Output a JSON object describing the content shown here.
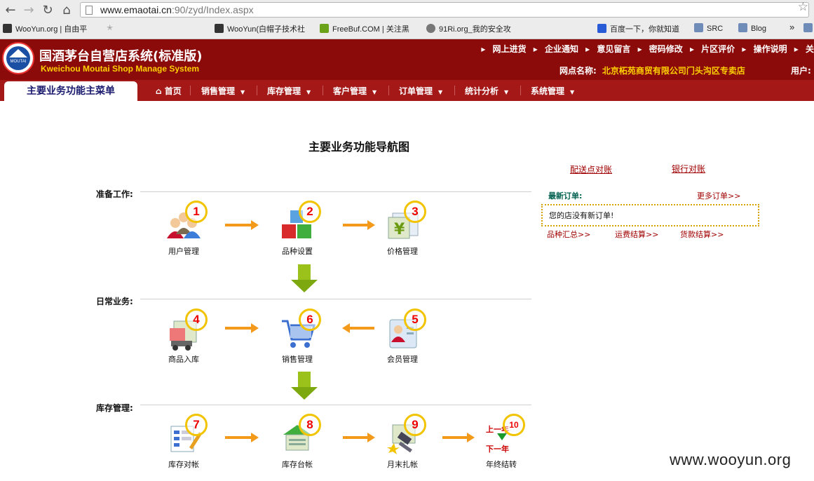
{
  "browser": {
    "url_main": "www.emaotai.cn",
    "url_rest": ":90/zyd/Index.aspx",
    "bookmarks": [
      {
        "label": "WooYun.org | 自由平",
        "color": "#333"
      },
      {
        "label": "WooYun(白帽子技术社",
        "color": "#333"
      },
      {
        "label": "FreeBuf.COM | 关注黑",
        "color": "#6aa21a"
      },
      {
        "label": "91Ri.org_我的安全攻",
        "color": "#777"
      },
      {
        "label": "百度一下，你就知道",
        "color": "#2a5bd7"
      },
      {
        "label": "SRC",
        "color": "#6f8cb8"
      },
      {
        "label": "Blog",
        "color": "#6f8cb8"
      }
    ],
    "more": "»"
  },
  "header": {
    "logo_text": "MOUTAI",
    "title_cn": "国酒茅台自营店系统(标准版)",
    "title_en": "Kweichou Moutai Shop Manage System",
    "top_links": [
      "网上进货",
      "企业通知",
      "意见留言",
      "密码修改",
      "片区评价",
      "操作说明",
      "关"
    ],
    "station_label": "网点名称:",
    "station_value": "北京柘苑商贸有限公司门头沟区专卖店",
    "user_label": "用户:"
  },
  "menu": {
    "main_tab": "主要业务功能主菜单",
    "home": "首页",
    "items": [
      "销售管理",
      "库存管理",
      "客户管理",
      "订单管理",
      "统计分析",
      "系统管理"
    ]
  },
  "main": {
    "title": "主要业务功能导航图",
    "sections": [
      "准备工作:",
      "日常业务:",
      "库存管理:"
    ],
    "nodes": [
      {
        "num": "1",
        "label": "用户管理"
      },
      {
        "num": "2",
        "label": "品种设置"
      },
      {
        "num": "3",
        "label": "价格管理"
      },
      {
        "num": "4",
        "label": "商品入库"
      },
      {
        "num": "6",
        "label": "销售管理"
      },
      {
        "num": "5",
        "label": "会员管理"
      },
      {
        "num": "7",
        "label": "库存对帐"
      },
      {
        "num": "8",
        "label": "库存台帐"
      },
      {
        "num": "9",
        "label": "月末扎帐"
      },
      {
        "num": "10",
        "label": "年终结转"
      }
    ],
    "year_prev": "上一年",
    "year_next": "下一年"
  },
  "sidebar": {
    "link_delivery": "配送点对账",
    "link_bank": "银行对账",
    "orders_title": "最新订单:",
    "more_orders": "更多订单>>",
    "no_orders": "您的店没有新订单!",
    "sub_links": [
      "品种汇总>>",
      "运费结算>>",
      "货款结算>>"
    ]
  },
  "watermark": "www.wooyun.org"
}
